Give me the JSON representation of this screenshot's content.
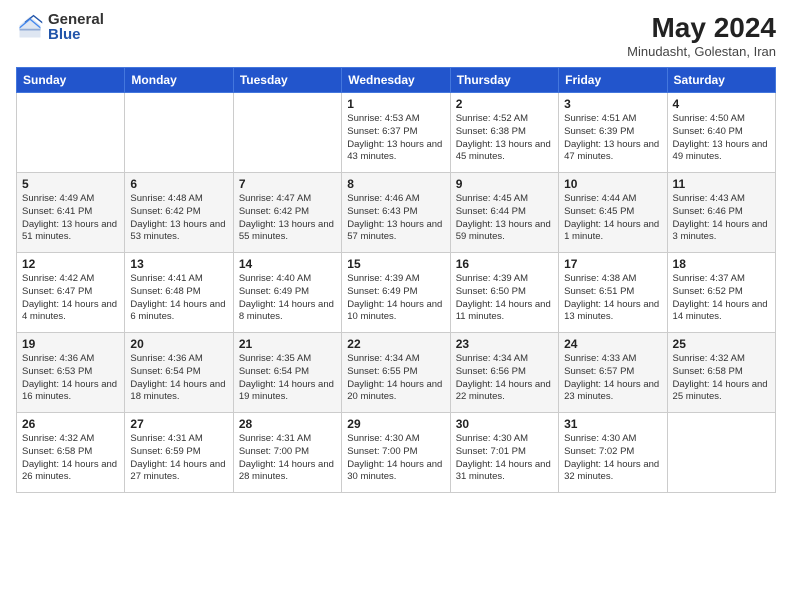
{
  "header": {
    "logo_general": "General",
    "logo_blue": "Blue",
    "title": "May 2024",
    "subtitle": "Minudasht, Golestan, Iran"
  },
  "days_of_week": [
    "Sunday",
    "Monday",
    "Tuesday",
    "Wednesday",
    "Thursday",
    "Friday",
    "Saturday"
  ],
  "weeks": [
    [
      {
        "day": "",
        "info": ""
      },
      {
        "day": "",
        "info": ""
      },
      {
        "day": "",
        "info": ""
      },
      {
        "day": "1",
        "info": "Sunrise: 4:53 AM\nSunset: 6:37 PM\nDaylight: 13 hours\nand 43 minutes."
      },
      {
        "day": "2",
        "info": "Sunrise: 4:52 AM\nSunset: 6:38 PM\nDaylight: 13 hours\nand 45 minutes."
      },
      {
        "day": "3",
        "info": "Sunrise: 4:51 AM\nSunset: 6:39 PM\nDaylight: 13 hours\nand 47 minutes."
      },
      {
        "day": "4",
        "info": "Sunrise: 4:50 AM\nSunset: 6:40 PM\nDaylight: 13 hours\nand 49 minutes."
      }
    ],
    [
      {
        "day": "5",
        "info": "Sunrise: 4:49 AM\nSunset: 6:41 PM\nDaylight: 13 hours\nand 51 minutes."
      },
      {
        "day": "6",
        "info": "Sunrise: 4:48 AM\nSunset: 6:42 PM\nDaylight: 13 hours\nand 53 minutes."
      },
      {
        "day": "7",
        "info": "Sunrise: 4:47 AM\nSunset: 6:42 PM\nDaylight: 13 hours\nand 55 minutes."
      },
      {
        "day": "8",
        "info": "Sunrise: 4:46 AM\nSunset: 6:43 PM\nDaylight: 13 hours\nand 57 minutes."
      },
      {
        "day": "9",
        "info": "Sunrise: 4:45 AM\nSunset: 6:44 PM\nDaylight: 13 hours\nand 59 minutes."
      },
      {
        "day": "10",
        "info": "Sunrise: 4:44 AM\nSunset: 6:45 PM\nDaylight: 14 hours\nand 1 minute."
      },
      {
        "day": "11",
        "info": "Sunrise: 4:43 AM\nSunset: 6:46 PM\nDaylight: 14 hours\nand 3 minutes."
      }
    ],
    [
      {
        "day": "12",
        "info": "Sunrise: 4:42 AM\nSunset: 6:47 PM\nDaylight: 14 hours\nand 4 minutes."
      },
      {
        "day": "13",
        "info": "Sunrise: 4:41 AM\nSunset: 6:48 PM\nDaylight: 14 hours\nand 6 minutes."
      },
      {
        "day": "14",
        "info": "Sunrise: 4:40 AM\nSunset: 6:49 PM\nDaylight: 14 hours\nand 8 minutes."
      },
      {
        "day": "15",
        "info": "Sunrise: 4:39 AM\nSunset: 6:49 PM\nDaylight: 14 hours\nand 10 minutes."
      },
      {
        "day": "16",
        "info": "Sunrise: 4:39 AM\nSunset: 6:50 PM\nDaylight: 14 hours\nand 11 minutes."
      },
      {
        "day": "17",
        "info": "Sunrise: 4:38 AM\nSunset: 6:51 PM\nDaylight: 14 hours\nand 13 minutes."
      },
      {
        "day": "18",
        "info": "Sunrise: 4:37 AM\nSunset: 6:52 PM\nDaylight: 14 hours\nand 14 minutes."
      }
    ],
    [
      {
        "day": "19",
        "info": "Sunrise: 4:36 AM\nSunset: 6:53 PM\nDaylight: 14 hours\nand 16 minutes."
      },
      {
        "day": "20",
        "info": "Sunrise: 4:36 AM\nSunset: 6:54 PM\nDaylight: 14 hours\nand 18 minutes."
      },
      {
        "day": "21",
        "info": "Sunrise: 4:35 AM\nSunset: 6:54 PM\nDaylight: 14 hours\nand 19 minutes."
      },
      {
        "day": "22",
        "info": "Sunrise: 4:34 AM\nSunset: 6:55 PM\nDaylight: 14 hours\nand 20 minutes."
      },
      {
        "day": "23",
        "info": "Sunrise: 4:34 AM\nSunset: 6:56 PM\nDaylight: 14 hours\nand 22 minutes."
      },
      {
        "day": "24",
        "info": "Sunrise: 4:33 AM\nSunset: 6:57 PM\nDaylight: 14 hours\nand 23 minutes."
      },
      {
        "day": "25",
        "info": "Sunrise: 4:32 AM\nSunset: 6:58 PM\nDaylight: 14 hours\nand 25 minutes."
      }
    ],
    [
      {
        "day": "26",
        "info": "Sunrise: 4:32 AM\nSunset: 6:58 PM\nDaylight: 14 hours\nand 26 minutes."
      },
      {
        "day": "27",
        "info": "Sunrise: 4:31 AM\nSunset: 6:59 PM\nDaylight: 14 hours\nand 27 minutes."
      },
      {
        "day": "28",
        "info": "Sunrise: 4:31 AM\nSunset: 7:00 PM\nDaylight: 14 hours\nand 28 minutes."
      },
      {
        "day": "29",
        "info": "Sunrise: 4:30 AM\nSunset: 7:00 PM\nDaylight: 14 hours\nand 30 minutes."
      },
      {
        "day": "30",
        "info": "Sunrise: 4:30 AM\nSunset: 7:01 PM\nDaylight: 14 hours\nand 31 minutes."
      },
      {
        "day": "31",
        "info": "Sunrise: 4:30 AM\nSunset: 7:02 PM\nDaylight: 14 hours\nand 32 minutes."
      },
      {
        "day": "",
        "info": ""
      }
    ]
  ]
}
